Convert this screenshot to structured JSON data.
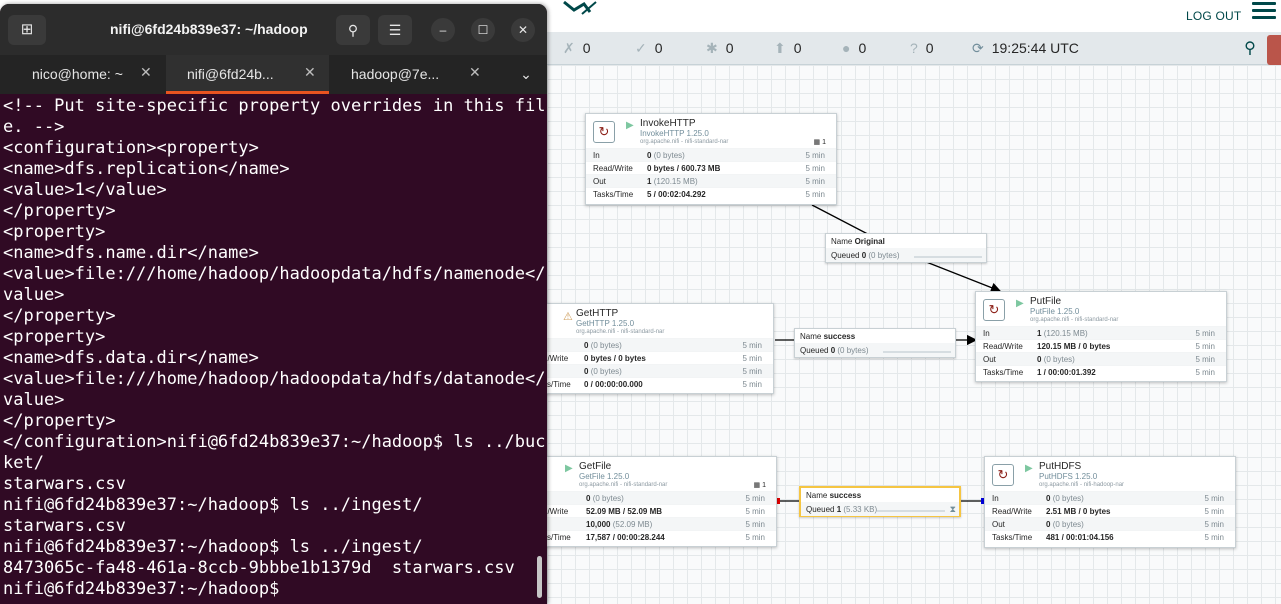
{
  "nifi": {
    "logout_label": "LOG OUT",
    "status": {
      "stopped": "0",
      "running_valid": "0",
      "invalid": "0",
      "disabled": "0",
      "warnings": "0",
      "unknown": "0",
      "time": "19:25:44 UTC"
    },
    "processors": {
      "invoke": {
        "name": "InvokeHTTP",
        "type": "InvokeHTTP 1.25.0",
        "bundle": "org.apache.nifi - nifi-standard-nar",
        "count": "1",
        "rows": [
          {
            "label": "In",
            "value": "0",
            "extra": "(0 bytes)",
            "window": "5 min"
          },
          {
            "label": "Read/Write",
            "value": "0 bytes / 600.73 MB",
            "extra": "",
            "window": "5 min"
          },
          {
            "label": "Out",
            "value": "1",
            "extra": "(120.15 MB)",
            "window": "5 min"
          },
          {
            "label": "Tasks/Time",
            "value": "5 / 00:02:04.292",
            "extra": "",
            "window": "5 min"
          }
        ]
      },
      "gethttp": {
        "name": "GetHTTP",
        "type": "GetHTTP 1.25.0",
        "bundle": "org.apache.nifi - nifi-standard-nar",
        "rows": [
          {
            "label": "",
            "value": "0",
            "extra": "(0 bytes)",
            "window": "5 min"
          },
          {
            "label": "d/Write",
            "value": "0 bytes / 0 bytes",
            "extra": "",
            "window": "5 min"
          },
          {
            "label": "",
            "value": "0",
            "extra": "(0 bytes)",
            "window": "5 min"
          },
          {
            "label": "ks/Time",
            "value": "0 / 00:00:00.000",
            "extra": "",
            "window": "5 min"
          }
        ]
      },
      "putfile": {
        "name": "PutFile",
        "type": "PutFile 1.25.0",
        "bundle": "org.apache.nifi - nifi-standard-nar",
        "rows": [
          {
            "label": "In",
            "value": "1",
            "extra": "(120.15 MB)",
            "window": "5 min"
          },
          {
            "label": "Read/Write",
            "value": "120.15 MB / 0 bytes",
            "extra": "",
            "window": "5 min"
          },
          {
            "label": "Out",
            "value": "0",
            "extra": "(0 bytes)",
            "window": "5 min"
          },
          {
            "label": "Tasks/Time",
            "value": "1 / 00:00:01.392",
            "extra": "",
            "window": "5 min"
          }
        ]
      },
      "getfile": {
        "name": "GetFile",
        "type": "GetFile 1.25.0",
        "bundle": "org.apache.nifi - nifi-standard-nar",
        "count": "1",
        "rows": [
          {
            "label": "",
            "value": "0",
            "extra": "(0 bytes)",
            "window": "5 min"
          },
          {
            "label": "d/Write",
            "value": "52.09 MB / 52.09 MB",
            "extra": "",
            "window": "5 min"
          },
          {
            "label": "",
            "value": "10,000",
            "extra": "(52.09 MB)",
            "window": "5 min"
          },
          {
            "label": "ks/Time",
            "value": "17,587 / 00:00:28.244",
            "extra": "",
            "window": "5 min"
          }
        ]
      },
      "puthdfs": {
        "name": "PutHDFS",
        "type": "PutHDFS 1.25.0",
        "bundle": "org.apache.nifi - nifi-hadoop-nar",
        "rows": [
          {
            "label": "In",
            "value": "0",
            "extra": "(0 bytes)",
            "window": "5 min"
          },
          {
            "label": "Read/Write",
            "value": "2.51 MB / 0 bytes",
            "extra": "",
            "window": "5 min"
          },
          {
            "label": "Out",
            "value": "0",
            "extra": "(0 bytes)",
            "window": "5 min"
          },
          {
            "label": "Tasks/Time",
            "value": "481 / 00:01:04.156",
            "extra": "",
            "window": "5 min"
          }
        ]
      }
    },
    "connections": {
      "original": {
        "name_label": "Name",
        "name": "Original",
        "queued_label": "Queued",
        "queued": "0",
        "queued_extra": "(0 bytes)"
      },
      "success1": {
        "name_label": "Name",
        "name": "success",
        "queued_label": "Queued",
        "queued": "0",
        "queued_extra": "(0 bytes)"
      },
      "success2": {
        "name_label": "Name",
        "name": "success",
        "queued_label": "Queued",
        "queued": "1",
        "queued_extra": "(5.33 KB)"
      }
    }
  },
  "terminal": {
    "window_title": "nifi@6fd24b839e37: ~/hadoop",
    "tabs": [
      {
        "label": "nico@home: ~"
      },
      {
        "label": "nifi@6fd24b..."
      },
      {
        "label": "hadoop@7e..."
      }
    ],
    "lines": [
      "<!-- Put site-specific property overrides in this fil",
      "e. -->",
      "<configuration><property>",
      "<name>dfs.replication</name>",
      "<value>1</value>",
      "</property>",
      "<property>",
      "<name>dfs.name.dir</name>",
      "<value>file:///home/hadoop/hadoopdata/hdfs/namenode</",
      "value>",
      "</property>",
      "<property>",
      "<name>dfs.data.dir</name>",
      "<value>file:///home/hadoop/hadoopdata/hdfs/datanode</",
      "value>",
      "</property>",
      "</configuration>nifi@6fd24b839e37:~/hadoop$ ls ../buc",
      "ket/",
      "starwars.csv",
      "nifi@6fd24b839e37:~/hadoop$ ls ../ingest/",
      "starwars.csv",
      "nifi@6fd24b839e37:~/hadoop$ ls ../ingest/",
      "8473065c-fa48-461a-8ccb-9bbbe1b1379d  starwars.csv",
      "nifi@6fd24b839e37:~/hadoop$"
    ]
  }
}
